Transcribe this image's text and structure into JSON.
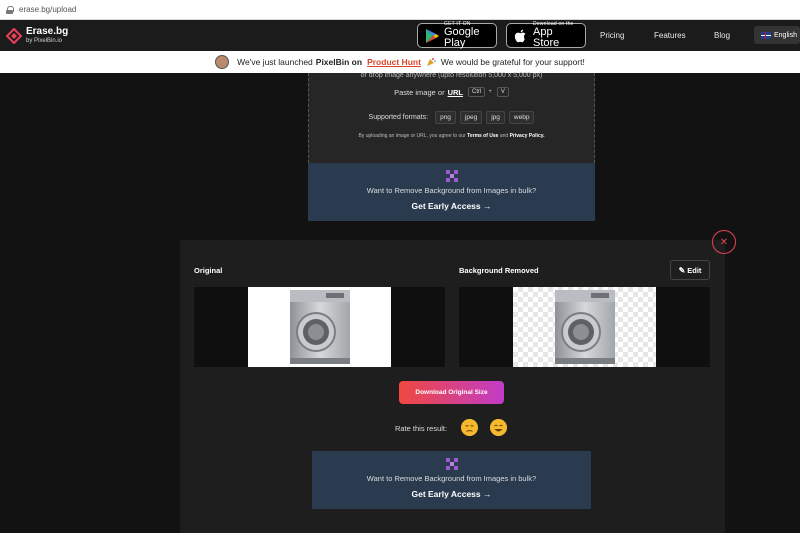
{
  "browser": {
    "url": "erase.bg/upload"
  },
  "nav": {
    "brand_name": "Erase.bg",
    "brand_sub": "by PixelBin.io",
    "google_play": {
      "small": "GET IT ON",
      "big": "Google Play"
    },
    "app_store": {
      "small": "Download on the",
      "big": "App Store"
    },
    "links": [
      "Pricing",
      "Features",
      "Blog"
    ],
    "language": "English"
  },
  "announcement": {
    "prefix": "We've just launched",
    "brand": "PixelBin on",
    "link": "Product Hunt",
    "suffix": "We would be grateful for your support!"
  },
  "upload": {
    "cut_line": "or drop image anywhere (upto resolution 5,000 x 5,000 px)",
    "paste_label": "Paste image or",
    "paste_url": "URL",
    "key_ctrl": "Ctrl",
    "key_plus": "+",
    "key_v": "V",
    "formats_label": "Supported formats:",
    "formats": [
      "png",
      "jpeg",
      "jpg",
      "webp"
    ],
    "terms_prefix": "By uploading an image or URL, you agree to our",
    "terms_link": "Terms of Use",
    "terms_and": "and",
    "privacy_link": "Privacy Policy."
  },
  "bulk": {
    "title": "Want to Remove Background from Images in bulk?",
    "cta": "Get Early Access →"
  },
  "results": {
    "original_label": "Original",
    "removed_label": "Background Removed",
    "edit_label": "Edit",
    "download_label": "Download Original Size",
    "rate_label": "Rate this result:"
  },
  "icons": {
    "close": "close-icon",
    "edit": "pencil-icon",
    "rate_bad": "sad-face-icon",
    "rate_good": "happy-face-icon"
  },
  "colors": {
    "accent_red": "#e94156",
    "gradient_start": "#f0483f",
    "gradient_end": "#c13cc7",
    "bulk_bg": "#2a3a4f"
  }
}
